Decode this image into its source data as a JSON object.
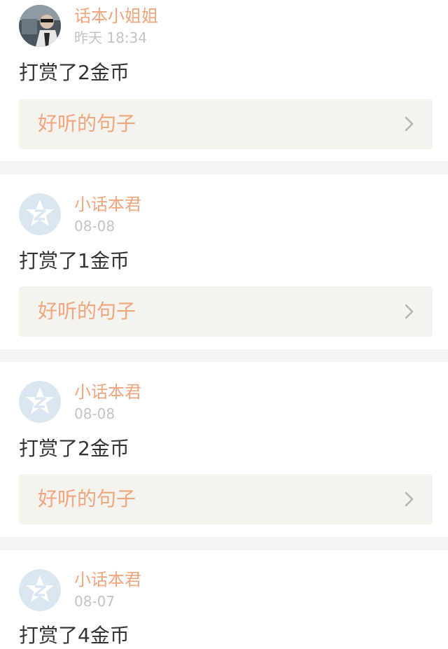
{
  "colors": {
    "accent": "#f0a57c",
    "text": "#333333",
    "muted": "#c4c4c4",
    "card_bg": "#ffffff",
    "page_bg": "#f5f5f5",
    "link_bg": "#f4f3ee"
  },
  "feed": {
    "items": [
      {
        "username": "话本小姐姐",
        "time": "昨天 18:34",
        "action": "打赏了2金币",
        "link_label": "好听的句子",
        "avatar_icon": "user-photo-avatar",
        "link_icon": "chevron-right-icon"
      },
      {
        "username": "小话本君",
        "time": "08-08",
        "action": "打赏了1金币",
        "link_label": "好听的句子",
        "avatar_icon": "default-qzone-star-avatar",
        "link_icon": "chevron-right-icon"
      },
      {
        "username": "小话本君",
        "time": "08-08",
        "action": "打赏了2金币",
        "link_label": "好听的句子",
        "avatar_icon": "default-qzone-star-avatar",
        "link_icon": "chevron-right-icon"
      },
      {
        "username": "小话本君",
        "time": "08-07",
        "action": "打赏了4金币",
        "avatar_icon": "default-qzone-star-avatar"
      }
    ]
  }
}
